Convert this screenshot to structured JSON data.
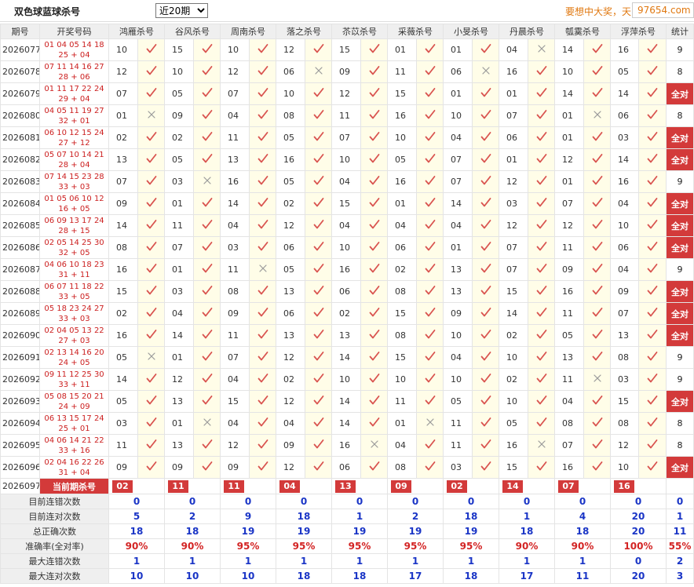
{
  "header": {
    "title": "双色球蓝球杀号",
    "select_value": "近20期",
    "promo": "要想中大奖，天",
    "brand": "97654.com"
  },
  "columns": [
    "期号",
    "开奖号码",
    "鸿雁杀号",
    "谷风杀号",
    "周南杀号",
    "落之杀号",
    "苶苡杀号",
    "采薇杀号",
    "小旻杀号",
    "丹晨杀号",
    "瓠霙杀号",
    "浮萍杀号",
    "统计"
  ],
  "rows": [
    {
      "period": "2026077",
      "line1": "01 04 05 14 18",
      "line2": "25 + 04",
      "kills": [
        "10",
        "15",
        "10",
        "12",
        "15",
        "01",
        "01",
        "04",
        "14",
        "16"
      ],
      "marks": [
        1,
        1,
        1,
        1,
        1,
        1,
        1,
        0,
        1,
        1
      ],
      "stat": "9"
    },
    {
      "period": "2026078",
      "line1": "07 11 14 16 27",
      "line2": "28 + 06",
      "kills": [
        "12",
        "10",
        "12",
        "06",
        "09",
        "11",
        "06",
        "16",
        "10",
        "05"
      ],
      "marks": [
        1,
        1,
        1,
        0,
        1,
        1,
        0,
        1,
        1,
        1
      ],
      "stat": "8"
    },
    {
      "period": "2026079",
      "line1": "01 11 17 22 24",
      "line2": "29 + 04",
      "kills": [
        "07",
        "05",
        "07",
        "10",
        "12",
        "15",
        "01",
        "01",
        "14",
        "14"
      ],
      "marks": [
        1,
        1,
        1,
        1,
        1,
        1,
        1,
        1,
        1,
        1
      ],
      "stat": "全对"
    },
    {
      "period": "2026080",
      "line1": "04 05 11 19 27",
      "line2": "32 + 01",
      "kills": [
        "01",
        "09",
        "04",
        "08",
        "11",
        "16",
        "10",
        "07",
        "01",
        "06"
      ],
      "marks": [
        0,
        1,
        1,
        1,
        1,
        1,
        1,
        1,
        0,
        1
      ],
      "stat": "8"
    },
    {
      "period": "2026081",
      "line1": "06 10 12 15 24",
      "line2": "27 + 12",
      "kills": [
        "02",
        "02",
        "11",
        "05",
        "07",
        "10",
        "04",
        "06",
        "01",
        "03"
      ],
      "marks": [
        1,
        1,
        1,
        1,
        1,
        1,
        1,
        1,
        1,
        1
      ],
      "stat": "全对"
    },
    {
      "period": "2026082",
      "line1": "05 07 10 14 21",
      "line2": "28 + 04",
      "kills": [
        "13",
        "05",
        "13",
        "16",
        "10",
        "05",
        "07",
        "01",
        "12",
        "14"
      ],
      "marks": [
        1,
        1,
        1,
        1,
        1,
        1,
        1,
        1,
        1,
        1
      ],
      "stat": "全对"
    },
    {
      "period": "2026083",
      "line1": "07 14 15 23 28",
      "line2": "33 + 03",
      "kills": [
        "07",
        "03",
        "16",
        "05",
        "04",
        "16",
        "07",
        "12",
        "01",
        "16"
      ],
      "marks": [
        1,
        0,
        1,
        1,
        1,
        1,
        1,
        1,
        1,
        1
      ],
      "stat": "9"
    },
    {
      "period": "2026084",
      "line1": "01 05 06 10 12",
      "line2": "16 + 05",
      "kills": [
        "09",
        "01",
        "14",
        "02",
        "15",
        "01",
        "14",
        "03",
        "07",
        "04"
      ],
      "marks": [
        1,
        1,
        1,
        1,
        1,
        1,
        1,
        1,
        1,
        1
      ],
      "stat": "全对"
    },
    {
      "period": "2026085",
      "line1": "06 09 13 17 24",
      "line2": "28 + 15",
      "kills": [
        "14",
        "11",
        "04",
        "12",
        "04",
        "04",
        "04",
        "12",
        "12",
        "10"
      ],
      "marks": [
        1,
        1,
        1,
        1,
        1,
        1,
        1,
        1,
        1,
        1
      ],
      "stat": "全对"
    },
    {
      "period": "2026086",
      "line1": "02 05 14 25 30",
      "line2": "32 + 05",
      "kills": [
        "08",
        "07",
        "03",
        "06",
        "10",
        "06",
        "01",
        "07",
        "11",
        "06"
      ],
      "marks": [
        1,
        1,
        1,
        1,
        1,
        1,
        1,
        1,
        1,
        1
      ],
      "stat": "全对"
    },
    {
      "period": "2026087",
      "line1": "04 06 10 18 23",
      "line2": "31 + 11",
      "kills": [
        "16",
        "01",
        "11",
        "05",
        "16",
        "02",
        "13",
        "07",
        "09",
        "04"
      ],
      "marks": [
        1,
        1,
        0,
        1,
        1,
        1,
        1,
        1,
        1,
        1
      ],
      "stat": "9"
    },
    {
      "period": "2026088",
      "line1": "06 07 11 18 22",
      "line2": "33 + 05",
      "kills": [
        "15",
        "03",
        "08",
        "13",
        "06",
        "08",
        "13",
        "15",
        "16",
        "09"
      ],
      "marks": [
        1,
        1,
        1,
        1,
        1,
        1,
        1,
        1,
        1,
        1
      ],
      "stat": "全对"
    },
    {
      "period": "2026089",
      "line1": "05 18 23 24 27",
      "line2": "33 + 03",
      "kills": [
        "02",
        "04",
        "09",
        "06",
        "02",
        "15",
        "09",
        "14",
        "11",
        "07"
      ],
      "marks": [
        1,
        1,
        1,
        1,
        1,
        1,
        1,
        1,
        1,
        1
      ],
      "stat": "全对"
    },
    {
      "period": "2026090",
      "line1": "02 04 05 13 22",
      "line2": "27 + 03",
      "kills": [
        "16",
        "14",
        "11",
        "13",
        "13",
        "08",
        "10",
        "02",
        "05",
        "13"
      ],
      "marks": [
        1,
        1,
        1,
        1,
        1,
        1,
        1,
        1,
        1,
        1
      ],
      "stat": "全对"
    },
    {
      "period": "2026091",
      "line1": "02 13 14 16 20",
      "line2": "24 + 05",
      "kills": [
        "05",
        "01",
        "07",
        "12",
        "14",
        "15",
        "04",
        "10",
        "13",
        "08"
      ],
      "marks": [
        0,
        1,
        1,
        1,
        1,
        1,
        1,
        1,
        1,
        1
      ],
      "stat": "9"
    },
    {
      "period": "2026092",
      "line1": "09 11 12 25 30",
      "line2": "33 + 11",
      "kills": [
        "14",
        "12",
        "04",
        "02",
        "10",
        "10",
        "10",
        "02",
        "11",
        "03"
      ],
      "marks": [
        1,
        1,
        1,
        1,
        1,
        1,
        1,
        1,
        0,
        1
      ],
      "stat": "9"
    },
    {
      "period": "2026093",
      "line1": "05 08 15 20 21",
      "line2": "24 + 09",
      "kills": [
        "05",
        "13",
        "15",
        "12",
        "14",
        "11",
        "05",
        "10",
        "04",
        "15"
      ],
      "marks": [
        1,
        1,
        1,
        1,
        1,
        1,
        1,
        1,
        1,
        1
      ],
      "stat": "全对"
    },
    {
      "period": "2026094",
      "line1": "06 13 15 17 24",
      "line2": "25 + 01",
      "kills": [
        "03",
        "01",
        "04",
        "04",
        "14",
        "01",
        "11",
        "05",
        "08",
        "08"
      ],
      "marks": [
        1,
        0,
        1,
        1,
        1,
        0,
        1,
        1,
        1,
        1
      ],
      "stat": "8"
    },
    {
      "period": "2026095",
      "line1": "04 06 14 21 22",
      "line2": "33 + 16",
      "kills": [
        "11",
        "13",
        "12",
        "09",
        "16",
        "04",
        "11",
        "16",
        "07",
        "12"
      ],
      "marks": [
        1,
        1,
        1,
        1,
        0,
        1,
        1,
        0,
        1,
        1
      ],
      "stat": "8"
    },
    {
      "period": "2026096",
      "line1": "02 04 16 22 26",
      "line2": "31 + 04",
      "kills": [
        "09",
        "09",
        "09",
        "12",
        "06",
        "08",
        "03",
        "15",
        "16",
        "10"
      ],
      "marks": [
        1,
        1,
        1,
        1,
        1,
        1,
        1,
        1,
        1,
        1
      ],
      "stat": "全对"
    }
  ],
  "current": {
    "period": "2026097",
    "label": "当前期杀号",
    "kills": [
      "02",
      "11",
      "11",
      "04",
      "13",
      "09",
      "02",
      "14",
      "07",
      "16"
    ]
  },
  "stats": [
    {
      "label": "目前连错次数",
      "values": [
        "0",
        "0",
        "0",
        "0",
        "0",
        "0",
        "0",
        "0",
        "0",
        "0",
        "0"
      ],
      "kind": "plain"
    },
    {
      "label": "目前连对次数",
      "values": [
        "5",
        "2",
        "9",
        "18",
        "1",
        "2",
        "18",
        "1",
        "4",
        "20",
        "1"
      ],
      "kind": "plain"
    },
    {
      "label": "总正确次数",
      "values": [
        "18",
        "18",
        "19",
        "19",
        "19",
        "19",
        "19",
        "18",
        "18",
        "20",
        "11"
      ],
      "kind": "plain"
    },
    {
      "label": "准确率(全对率)",
      "values": [
        "90%",
        "90%",
        "95%",
        "95%",
        "95%",
        "95%",
        "95%",
        "90%",
        "90%",
        "100%",
        "55%"
      ],
      "kind": "rate"
    },
    {
      "label": "最大连错次数",
      "values": [
        "1",
        "1",
        "1",
        "1",
        "1",
        "1",
        "1",
        "1",
        "1",
        "0",
        "2"
      ],
      "kind": "plain"
    },
    {
      "label": "最大连对次数",
      "values": [
        "10",
        "10",
        "10",
        "18",
        "18",
        "17",
        "18",
        "17",
        "11",
        "20",
        "3"
      ],
      "kind": "plain"
    }
  ],
  "icons": {
    "correct": "check-icon",
    "wrong": "cross-icon"
  },
  "colors": {
    "accent_red": "#d33a3a",
    "number_blue": "#1a35c6",
    "rate_red": "#d32424",
    "mark_bg": "#fffde8",
    "promo_orange": "#e07810"
  }
}
